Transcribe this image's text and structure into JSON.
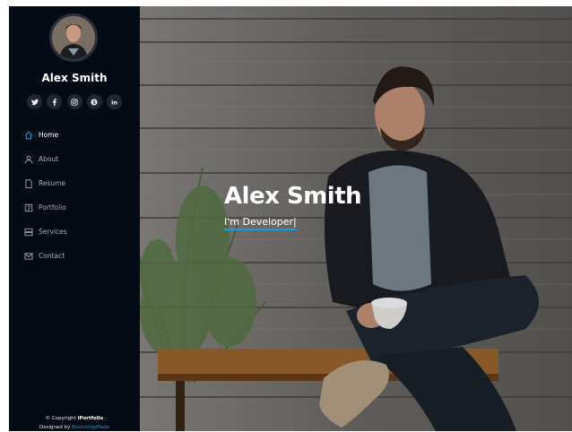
{
  "sidebar": {
    "profile_name": "Alex Smith",
    "social": [
      {
        "icon": "twitter-icon",
        "glyph": "🐦"
      },
      {
        "icon": "facebook-icon",
        "glyph": "f"
      },
      {
        "icon": "instagram-icon",
        "glyph": "◎"
      },
      {
        "icon": "skype-icon",
        "glyph": "S"
      },
      {
        "icon": "linkedin-icon",
        "glyph": "in"
      }
    ],
    "nav": [
      {
        "label": "Home",
        "icon": "home-icon",
        "active": true
      },
      {
        "label": "About",
        "icon": "person-icon",
        "active": false
      },
      {
        "label": "Resume",
        "icon": "file-icon",
        "active": false
      },
      {
        "label": "Portfolio",
        "icon": "book-icon",
        "active": false
      },
      {
        "label": "Services",
        "icon": "server-icon",
        "active": false
      },
      {
        "label": "Contact",
        "icon": "envelope-icon",
        "active": false
      }
    ],
    "footer": {
      "copyright_prefix": "© Copyright ",
      "brand": "iPortfolio",
      "designed_prefix": "Designed by ",
      "designed_link": "BootstrapMade"
    }
  },
  "hero": {
    "title": "Alex Smith",
    "subtitle": "I'm Developer|"
  },
  "colors": {
    "sidebar_bg": "#040b14",
    "accent": "#149ddd",
    "social_bg": "#212431"
  }
}
